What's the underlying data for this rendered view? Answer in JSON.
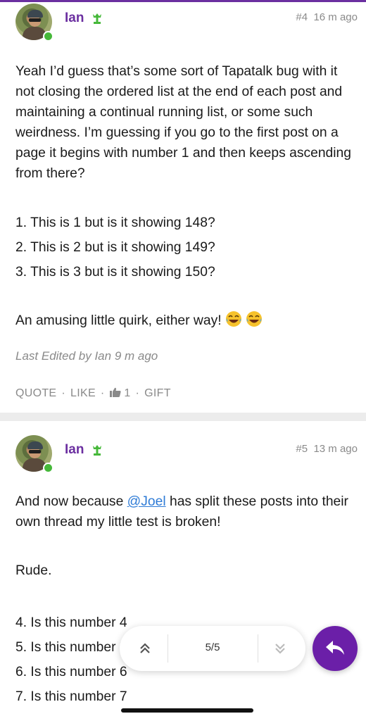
{
  "posts": [
    {
      "username": "Ian",
      "number": "#4",
      "time": "16 m ago",
      "body": [
        "Yeah I’d guess that’s some sort of Tapatalk bug with it not closing the ordered list at the end of each post and maintaining a continual running list, or some such weirdness. I’m guessing if you go to the first post on a page it begins with number 1 and then keeps ascending from there?"
      ],
      "list": [
        "1. This is 1 but is it showing 148?",
        "2. This is 2 but is it showing 149?",
        "3. This is 3 but is it showing 150?"
      ],
      "closing": "An amusing little quirk, either way!",
      "closing_emoji": "laughing-tears-emoji",
      "edited": "Last Edited by Ian 9 m ago",
      "actions": {
        "quote": "QUOTE",
        "like": "LIKE",
        "like_count": "1",
        "gift": "GIFT"
      }
    },
    {
      "username": "Ian",
      "number": "#5",
      "time": "13 m ago",
      "body_before_mention": "And now because ",
      "mention": "@Joel",
      "body_after_mention": " has split these posts into their own thread my little test is broken!",
      "line2": "Rude.",
      "list": [
        "4. Is this number 4",
        "5. Is this number 5",
        "6. Is this number 6",
        "7. Is this number 7"
      ]
    }
  ],
  "pager": {
    "label": "5/5",
    "up_icon": "double-chevron-up-icon",
    "down_icon": "double-chevron-down-icon"
  },
  "fab": {
    "icon": "reply-icon"
  },
  "colors": {
    "accent": "#6b2fa0",
    "fab": "#6b1fa8",
    "muted": "#8a8a8a",
    "link": "#2e7bd6",
    "online": "#46b83a"
  }
}
